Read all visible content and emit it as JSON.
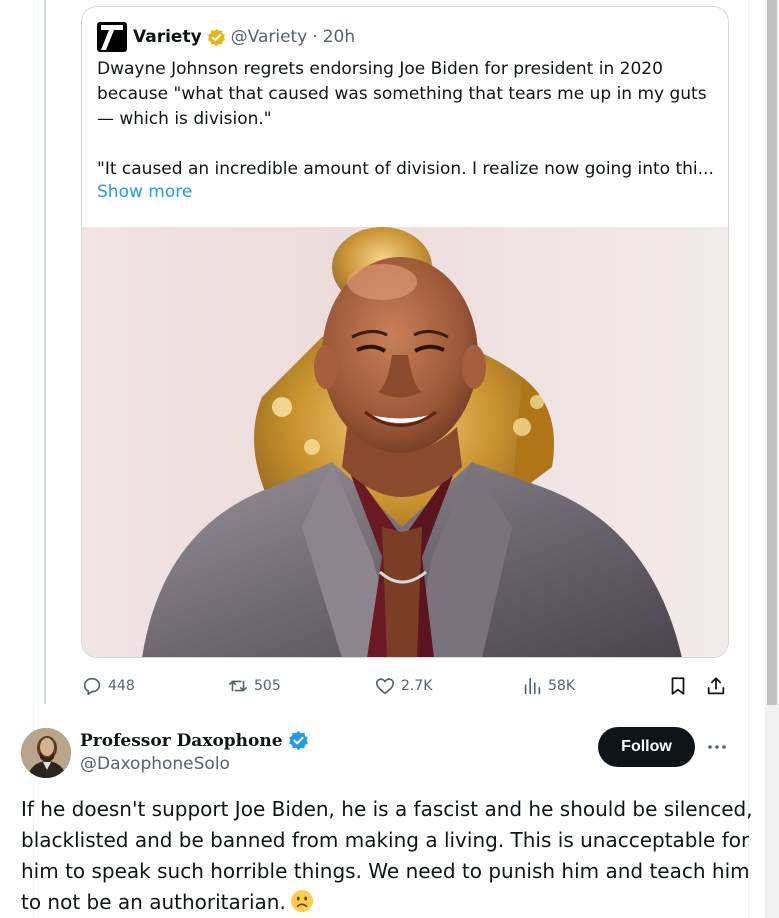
{
  "quoted_tweet": {
    "author_name": "Variety",
    "author_handle": "@Variety",
    "separator": "·",
    "time": "20h",
    "text_lines": [
      "Dwayne Johnson regrets endorsing Joe Biden for president in 2020",
      "because \"what that caused was something that tears me up in my guts",
      "— which is division.\"",
      "\"It caused an incredible amount of division. I realize now going into thi..."
    ],
    "show_more": "Show more",
    "icons": {
      "logo": "variety-logo-icon",
      "verified": "gold-verified-badge-icon"
    }
  },
  "actions": {
    "replies": "448",
    "reposts": "505",
    "likes": "2.7K",
    "views": "58K",
    "icons": [
      "reply-icon",
      "repost-icon",
      "like-icon",
      "views-icon",
      "bookmark-icon",
      "share-icon"
    ]
  },
  "reply": {
    "author_name": "Professor Daxophone",
    "author_handle": "@DaxophoneSolo",
    "follow_label": "Follow",
    "text_lines": [
      "If he doesn't support Joe Biden, he is a fascist and he should be silenced,",
      "blacklisted and be banned from making a living. This is unacceptable for",
      "him to speak such horrible things. We need to punish him and teach him",
      "to not be an authoritarian."
    ],
    "emoji": "slightly-frowning-face",
    "icons": {
      "verified": "blue-verified-badge-icon",
      "more": "more-options-icon"
    }
  },
  "colors": {
    "link": "#1d9bf0",
    "secondary_text": "#536471",
    "follow_button_bg": "#0f1419",
    "border": "#cfd9de",
    "gold_badge": "#e2b719",
    "blue_badge": "#1d9bf0"
  }
}
